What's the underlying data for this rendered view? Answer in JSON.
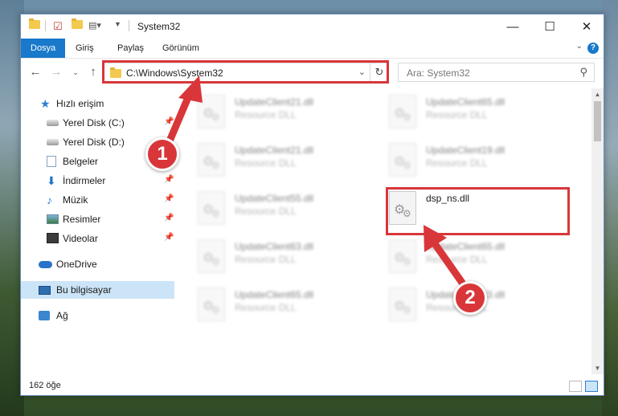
{
  "window": {
    "title": "System32"
  },
  "titlebar": {
    "minimize": "—",
    "maximize": "☐",
    "close": "✕"
  },
  "ribbon": {
    "tabs": [
      {
        "label": "Dosya"
      },
      {
        "label": "Giriş"
      },
      {
        "label": "Paylaş"
      },
      {
        "label": "Görünüm"
      }
    ],
    "help": "?"
  },
  "navbar": {
    "address": "C:\\Windows\\System32",
    "search_placeholder": "Ara: System32"
  },
  "sidebar": {
    "items": [
      {
        "label": "Hızlı erişim"
      },
      {
        "label": "Yerel Disk (C:)"
      },
      {
        "label": "Yerel Disk (D:)"
      },
      {
        "label": "Belgeler"
      },
      {
        "label": "İndirmeler"
      },
      {
        "label": "Müzik"
      },
      {
        "label": "Resimler"
      },
      {
        "label": "Videolar"
      },
      {
        "label": "OneDrive"
      },
      {
        "label": "Bu bilgisayar"
      },
      {
        "label": "Ağ"
      }
    ]
  },
  "files": [
    {
      "name": "UpdateClient21.dll",
      "type": "Resource DLL"
    },
    {
      "name": "UpdateClient65.dll",
      "type": "Resource DLL"
    },
    {
      "name": "UpdateClient21.dll",
      "type": "Resource DLL"
    },
    {
      "name": "UpdateClient19.dll",
      "type": "Resource DLL"
    },
    {
      "name": "UpdateClient55.dll",
      "type": "Resource DLL"
    },
    {
      "name": "dsp_ns.dll",
      "type": ""
    },
    {
      "name": "UpdateClient63.dll",
      "type": "Resource DLL"
    },
    {
      "name": "UpdateClient65.dll",
      "type": "Resource DLL"
    },
    {
      "name": "UpdateClient65.dll",
      "type": "Resource DLL"
    },
    {
      "name": "UpdateClient63.dll",
      "type": "Resource DLL"
    }
  ],
  "statusbar": {
    "count": "162 öğe"
  },
  "annotations": {
    "badge1": "1",
    "badge2": "2",
    "color": "#d9363a"
  }
}
